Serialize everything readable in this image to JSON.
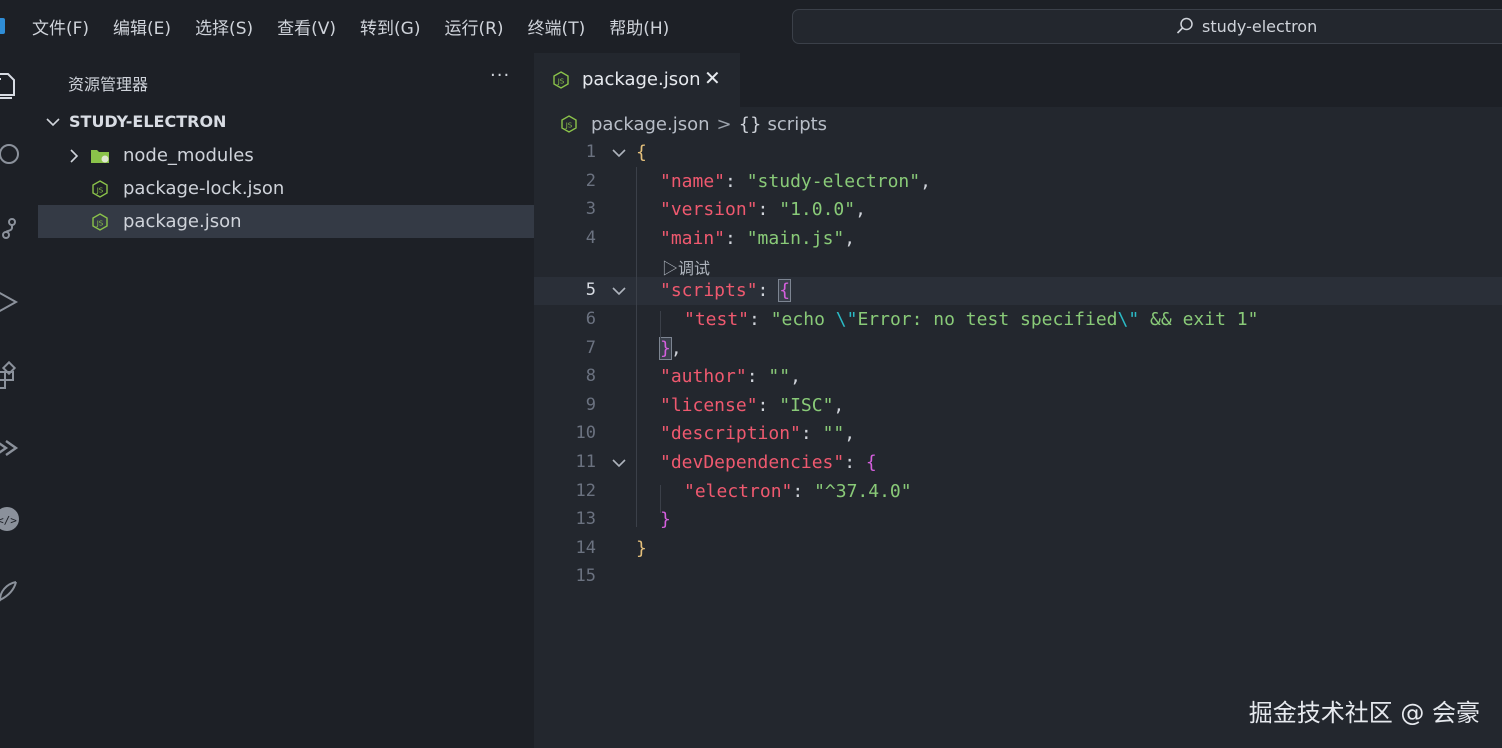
{
  "menubar": {
    "items": [
      "文件(F)",
      "编辑(E)",
      "选择(S)",
      "查看(V)",
      "转到(G)",
      "运行(R)",
      "终端(T)",
      "帮助(H)"
    ]
  },
  "command_center": {
    "text": "study-electron",
    "icon": "search-icon"
  },
  "activity_bar": {
    "icons": [
      "explorer-icon",
      "search-icon",
      "source-control-icon",
      "run-debug-icon",
      "extensions-icon",
      "remote-explorer-icon",
      "api-tool-icon",
      "feather-icon"
    ]
  },
  "sidebar": {
    "title": "资源管理器",
    "more": "···",
    "folder": "STUDY-ELECTRON",
    "items": [
      {
        "label": "node_modules",
        "type": "folder",
        "icon": "folder-icon"
      },
      {
        "label": "package-lock.json",
        "type": "file",
        "icon": "nodejs-file-icon"
      },
      {
        "label": "package.json",
        "type": "file",
        "icon": "nodejs-file-icon",
        "selected": true
      }
    ]
  },
  "tabs": [
    {
      "label": "package.json",
      "close": "✕",
      "active": true
    }
  ],
  "breadcrumb": {
    "file": "package.json",
    "separator": ">",
    "symbol_icon": "{}",
    "symbol": "scripts"
  },
  "editor": {
    "active_line": 5,
    "codelens": "▷调试",
    "lines": [
      {
        "num": "1",
        "fold": true,
        "tokens": [
          [
            "b1",
            "{"
          ]
        ]
      },
      {
        "num": "2",
        "tokens": [
          [
            "key",
            "\"name\""
          ],
          [
            "punc",
            ": "
          ],
          [
            "str",
            "\"study-electron\""
          ],
          [
            "punc",
            ","
          ]
        ]
      },
      {
        "num": "3",
        "tokens": [
          [
            "key",
            "\"version\""
          ],
          [
            "punc",
            ": "
          ],
          [
            "str",
            "\"1.0.0\""
          ],
          [
            "punc",
            ","
          ]
        ]
      },
      {
        "num": "4",
        "tokens": [
          [
            "key",
            "\"main\""
          ],
          [
            "punc",
            ": "
          ],
          [
            "str",
            "\"main.js\""
          ],
          [
            "punc",
            ","
          ]
        ]
      },
      {
        "num": "5",
        "fold": true,
        "tokens": [
          [
            "key",
            "\"scripts\""
          ],
          [
            "punc",
            ": "
          ],
          [
            "b2m",
            "{"
          ]
        ]
      },
      {
        "num": "6",
        "tokens": [
          [
            "key",
            "\"test\""
          ],
          [
            "punc",
            ": "
          ],
          [
            "str",
            "\"echo "
          ],
          [
            "esc",
            "\\\""
          ],
          [
            "str",
            "Error: no test specified"
          ],
          [
            "esc",
            "\\\""
          ],
          [
            "str",
            " && exit 1\""
          ]
        ]
      },
      {
        "num": "7",
        "tokens": [
          [
            "b2m",
            "}"
          ],
          [
            "punc",
            ","
          ]
        ]
      },
      {
        "num": "8",
        "tokens": [
          [
            "key",
            "\"author\""
          ],
          [
            "punc",
            ": "
          ],
          [
            "str",
            "\"\""
          ],
          [
            "punc",
            ","
          ]
        ]
      },
      {
        "num": "9",
        "tokens": [
          [
            "key",
            "\"license\""
          ],
          [
            "punc",
            ": "
          ],
          [
            "str",
            "\"ISC\""
          ],
          [
            "punc",
            ","
          ]
        ]
      },
      {
        "num": "10",
        "tokens": [
          [
            "key",
            "\"description\""
          ],
          [
            "punc",
            ": "
          ],
          [
            "str",
            "\"\""
          ],
          [
            "punc",
            ","
          ]
        ]
      },
      {
        "num": "11",
        "fold": true,
        "tokens": [
          [
            "key",
            "\"devDependencies\""
          ],
          [
            "punc",
            ": "
          ],
          [
            "b2",
            "{"
          ]
        ]
      },
      {
        "num": "12",
        "tokens": [
          [
            "key",
            "\"electron\""
          ],
          [
            "punc",
            ": "
          ],
          [
            "str",
            "\"^37.4.0\""
          ]
        ]
      },
      {
        "num": "13",
        "tokens": [
          [
            "b2",
            "}"
          ]
        ]
      },
      {
        "num": "14",
        "tokens": [
          [
            "b1",
            "}"
          ]
        ]
      },
      {
        "num": "15",
        "tokens": []
      }
    ]
  },
  "watermark": "掘金技术社区 @ 会豪",
  "colors": {
    "key": "#ef596f",
    "string": "#89ca78",
    "bracket_level1": "#e5c07b",
    "bracket_level2": "#d55fde",
    "escape": "#2bbac5",
    "background": "#23272e",
    "sidebar": "#1d2026"
  }
}
